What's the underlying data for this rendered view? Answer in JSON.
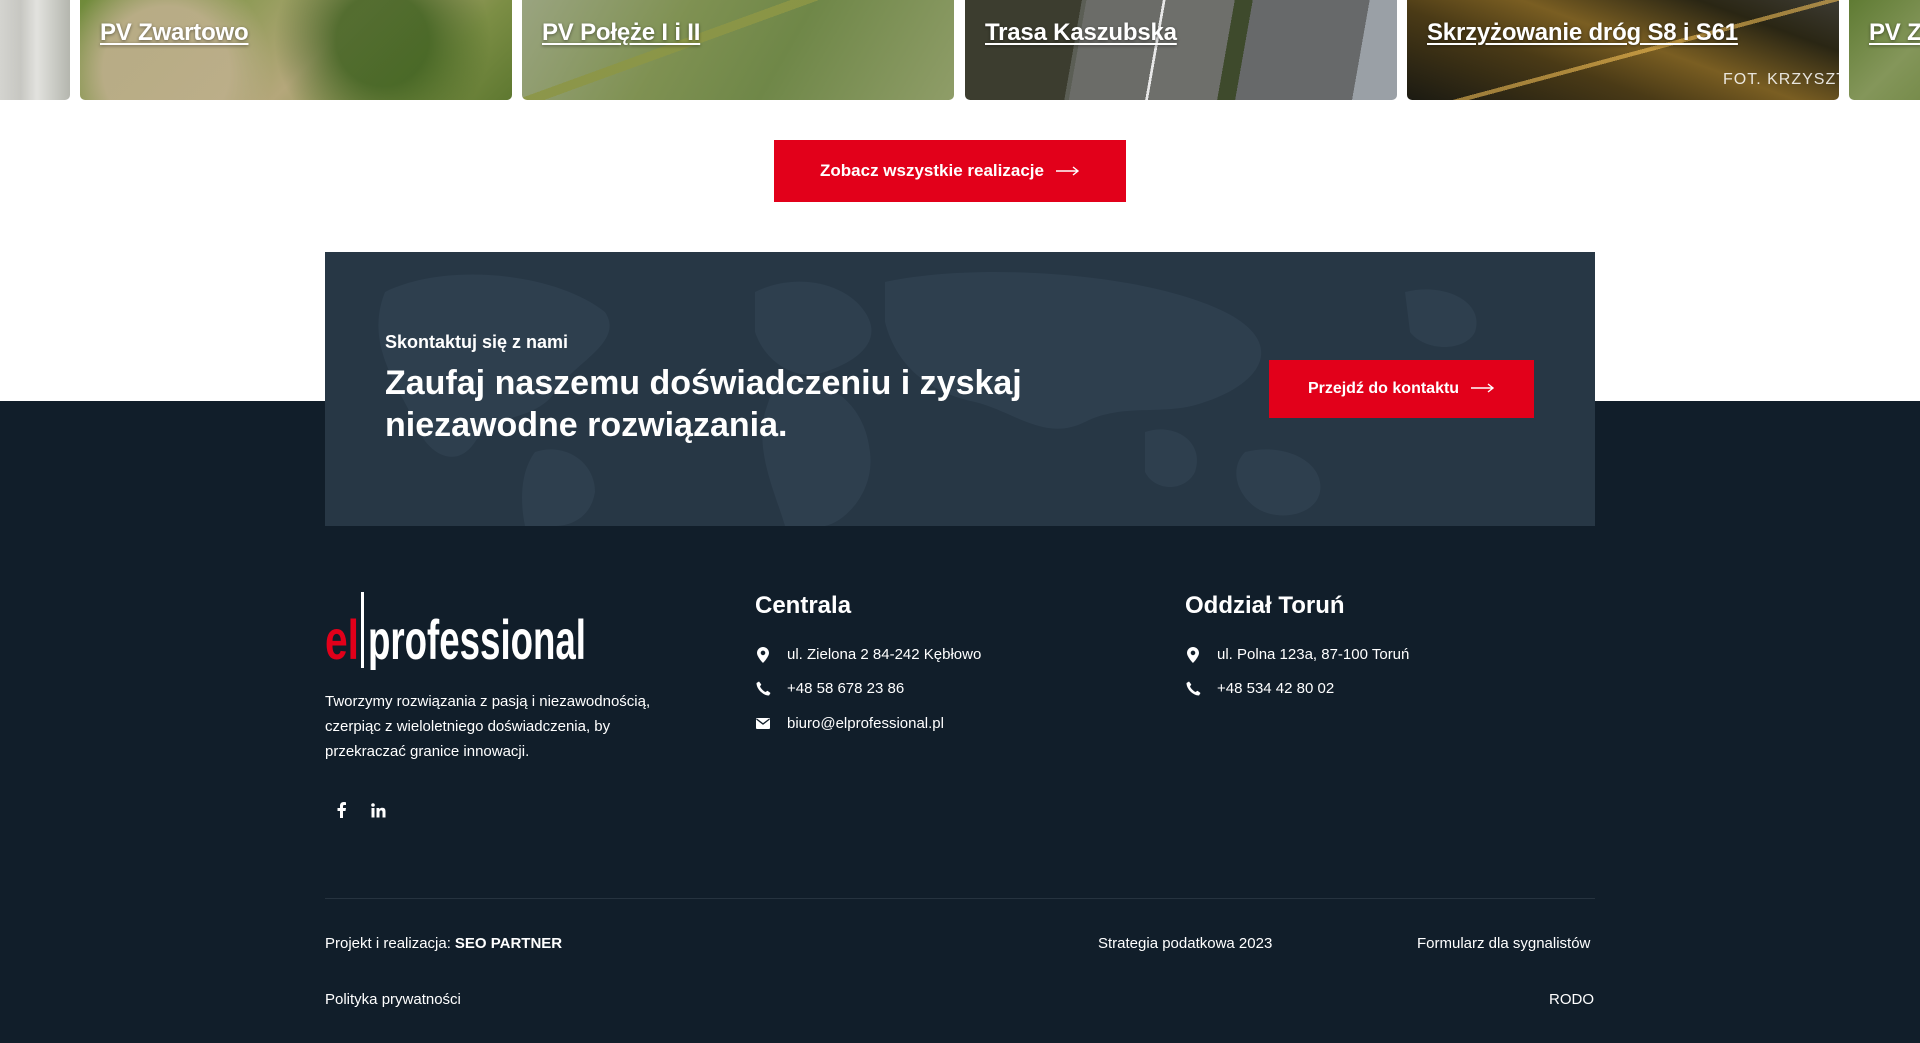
{
  "projects": {
    "cards": [
      {
        "title": ""
      },
      {
        "title": "PV Zwartowo"
      },
      {
        "title": "PV Połęże I i II"
      },
      {
        "title": "Trasa Kaszubska"
      },
      {
        "title": "Skrzyżowanie dróg S8 i S61",
        "photo_credit": "FOT. KRZYSZTO"
      },
      {
        "title": "PV Z"
      }
    ],
    "see_all_label": "Zobacz wszystkie realizacje"
  },
  "cta": {
    "kicker": "Skontaktuj się z nami",
    "heading": "Zaufaj naszemu doświadczeniu i zyskaj niezawodne rozwiązania.",
    "button_label": "Przejdź do kontaktu"
  },
  "footer": {
    "logo": {
      "part1": "el",
      "part2": "professional"
    },
    "about": "Tworzymy rozwiązania z pasją i niezawodnością, czerpiąc z wieloletniego doświadczenia, by przekraczać granice innowacji.",
    "centrala": {
      "title": "Centrala",
      "address": "ul. Zielona 2 84-242 Kębłowo",
      "phone": "+48 58 678 23 86",
      "email": "biuro@elprofessional.pl"
    },
    "torun": {
      "title": "Oddział Toruń",
      "address": "ul. Polna 123a, 87-100 Toruń",
      "phone": "+48 534 42 80 02"
    },
    "bottom": {
      "credit_prefix": "Projekt i realizacja:",
      "credit_name": "SEO PARTNER",
      "strategy": "Strategia podatkowa 2023",
      "whistleblower": "Formularz dla sygnalistów",
      "privacy": "Polityka prywatności",
      "rodo": "RODO"
    }
  },
  "colors": {
    "brand_red": "#e2001a",
    "footer_bg": "#111e2a",
    "cta_bg": "#273745"
  },
  "icons": [
    "arrow-right-icon",
    "location-pin-icon",
    "phone-icon",
    "envelope-icon",
    "facebook-icon",
    "linkedin-icon"
  ]
}
